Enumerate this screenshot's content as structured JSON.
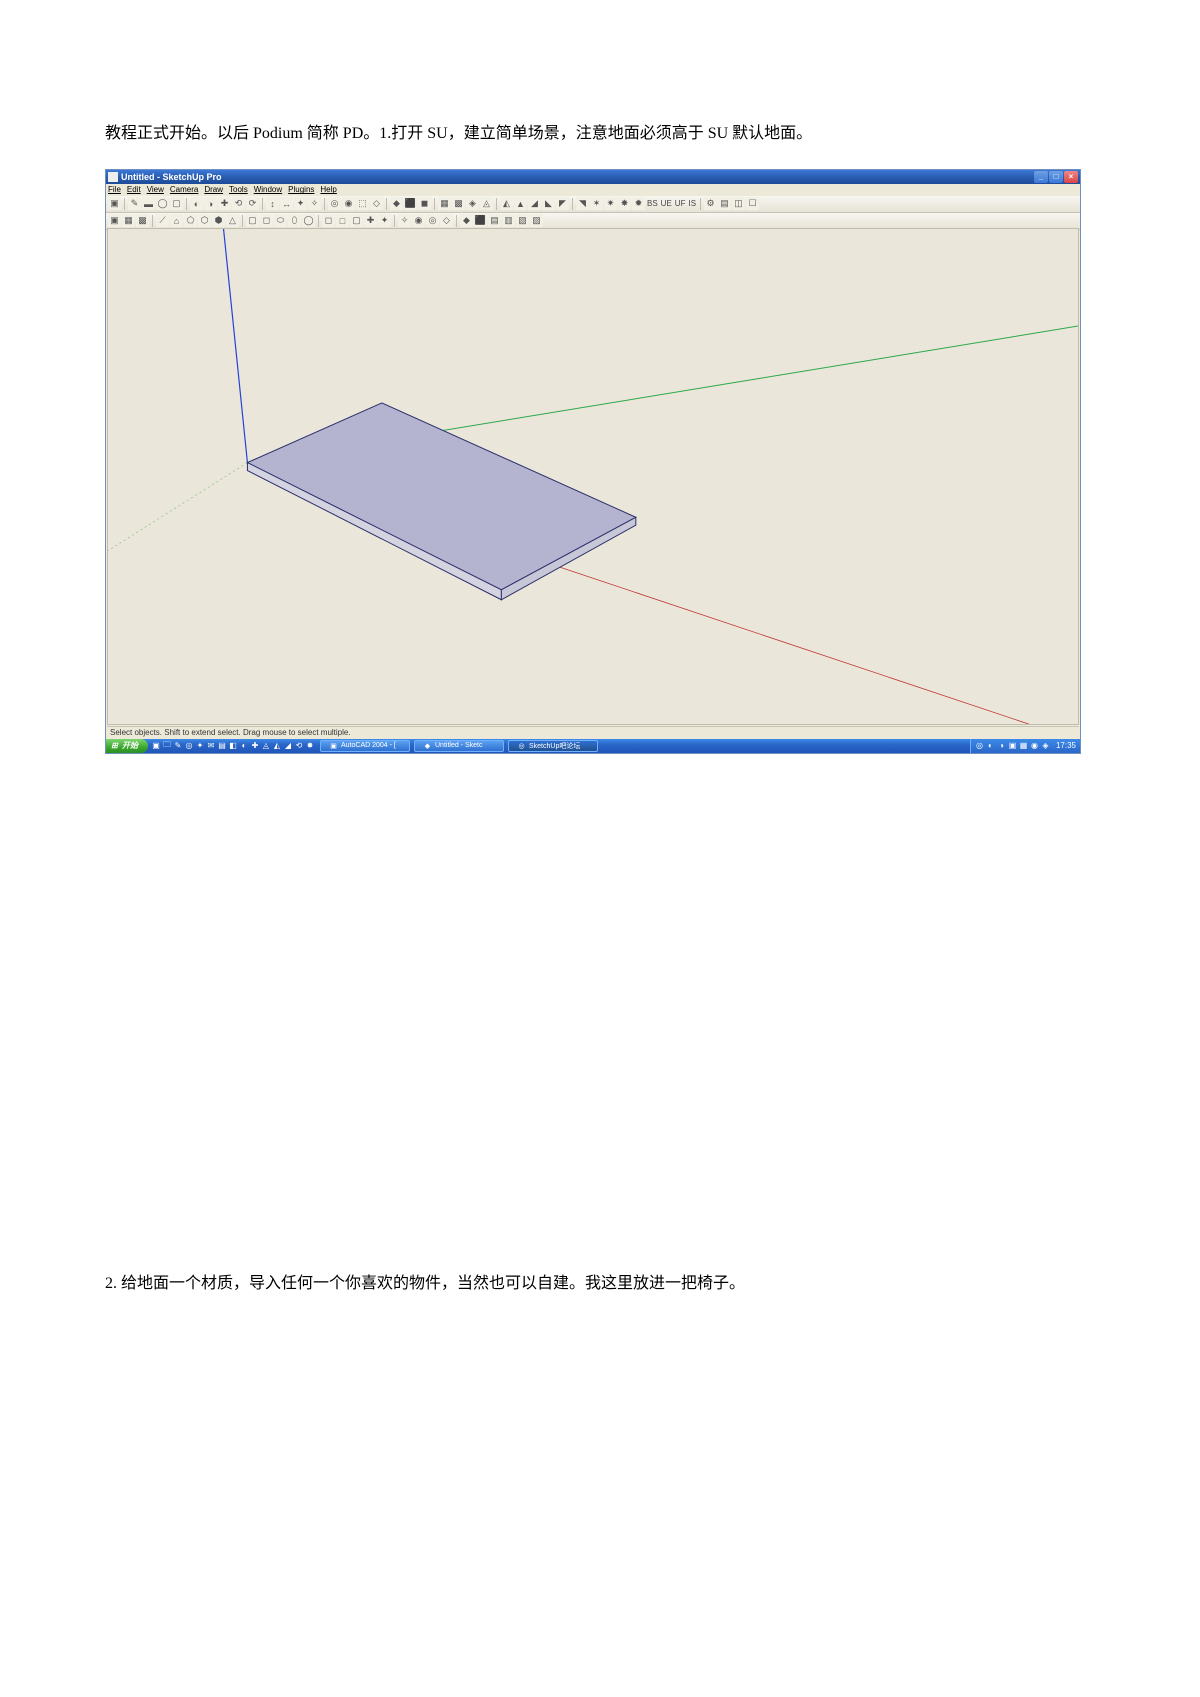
{
  "paragraphs": {
    "intro": "教程正式开始。以后 Podium 简称 PD。1.打开 SU，建立简单场景，注意地面必须高于 SU 默认地面。",
    "second": "2. 给地面一个材质，导入任何一个你喜欢的物件，当然也可以自建。我这里放进一把椅子。"
  },
  "app": {
    "title": "Untitled - SketchUp Pro",
    "menus": [
      "File",
      "Edit",
      "View",
      "Camera",
      "Draw",
      "Tools",
      "Window",
      "Plugins",
      "Help"
    ],
    "toolbar_row1_icons": [
      "▣",
      "✎",
      "▬",
      "◯",
      "▢",
      "◐",
      "◑",
      "✚",
      "⟲",
      "⟳",
      "↕",
      "↔",
      "✦",
      "✧",
      "◎",
      "◉",
      "⬚",
      "◇",
      "◆",
      "⬛",
      "◼",
      "▦",
      "▩",
      "◈",
      "◬",
      "◭",
      "▲",
      "◢",
      "◣",
      "◤",
      "◥",
      "✶",
      "✷",
      "✸",
      "✹"
    ],
    "toolbar_row1_labels": [
      "BS",
      "UE",
      "UF",
      "IS"
    ],
    "toolbar_row1_tail": [
      "⚙",
      "▤",
      "◫",
      "☐"
    ],
    "toolbar_row2_icons": [
      "▣",
      "▦",
      "▩",
      "⟋",
      "⌂",
      "⬠",
      "⬡",
      "⬢",
      "△",
      "▢",
      "◻",
      "⬭",
      "⬯",
      "◯",
      "◻",
      "□",
      "▢",
      "✚",
      "✦",
      "✧",
      "◉",
      "◎",
      "◇",
      "◆",
      "⬛",
      "▤",
      "▥",
      "▧",
      "▨"
    ],
    "status": "Select objects. Shift to extend select. Drag mouse to select multiple.",
    "win_buttons": {
      "min": "_",
      "max": "□",
      "close": "×"
    }
  },
  "taskbar": {
    "start": "开始",
    "quicklaunch": [
      "▣",
      "🗀",
      "✎",
      "◎",
      "✦",
      "✉",
      "▤",
      "◧",
      "◐",
      "✚",
      "◬",
      "◭",
      "◢",
      "⟲",
      "✸"
    ],
    "task_items": [
      {
        "icon": "▣",
        "label": "AutoCAD 2004 - [",
        "active": false
      },
      {
        "icon": "◆",
        "label": "Untitled - Sketc",
        "active": false
      },
      {
        "icon": "◎",
        "label": "SketchUp吧论坛",
        "active": true
      }
    ],
    "tray_icons": [
      "◎",
      "◐",
      "◑",
      "▣",
      "▦",
      "◉",
      "◈"
    ],
    "clock": "17:35"
  }
}
